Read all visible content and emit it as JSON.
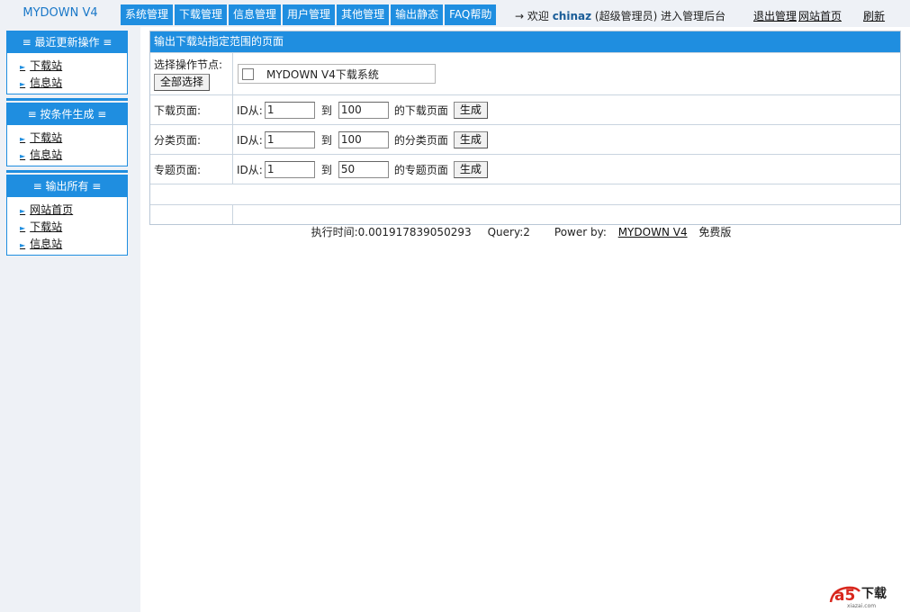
{
  "app": {
    "title": "MYDOWN V4"
  },
  "nav": [
    "系统管理",
    "下载管理",
    "信息管理",
    "用户管理",
    "其他管理",
    "输出静态",
    "FAQ帮助"
  ],
  "welcome": {
    "prefix": "→ 欢迎 ",
    "user": "chinaz",
    "suffix": " (超级管理员) 进入管理后台"
  },
  "toplinks": {
    "logout": "退出管理",
    "home": "网站首页",
    "refresh": "刷新"
  },
  "sidebar": {
    "panels": [
      {
        "title": "≡ 最近更新操作 ≡",
        "items": [
          "下载站",
          "信息站"
        ]
      },
      {
        "title": "≡ 按条件生成 ≡",
        "items": [
          "下载站",
          "信息站"
        ]
      },
      {
        "title": "≡ 输出所有 ≡",
        "items": [
          "网站首页",
          "下载站",
          "信息站"
        ]
      }
    ]
  },
  "main": {
    "title": "输出下载站指定范围的页面",
    "node_label": "选择操作节点:",
    "select_all": "全部选择",
    "node_name": "MYDOWN V4下载系统",
    "id_from": "ID从:",
    "to": "到",
    "gen": "生成",
    "rows": [
      {
        "label": "下载页面:",
        "from": "1",
        "to": "100",
        "suffix": "的下载页面"
      },
      {
        "label": "分类页面:",
        "from": "1",
        "to": "100",
        "suffix": "的分类页面"
      },
      {
        "label": "专题页面:",
        "from": "1",
        "to": "50",
        "suffix": "的专题页面"
      }
    ]
  },
  "footer": {
    "time": "执行时间:0.001917839050293",
    "query": "Query:2",
    "power_prefix": "Power by: ",
    "power_link": "MYDOWN V4",
    "power_suffix": " 免费版"
  },
  "watermark": {
    "mark": "a5",
    "text": "下载",
    "url": "xiazai.com"
  },
  "colors": {
    "accent": "#1f8ee0",
    "brand_red": "#d8261c"
  }
}
